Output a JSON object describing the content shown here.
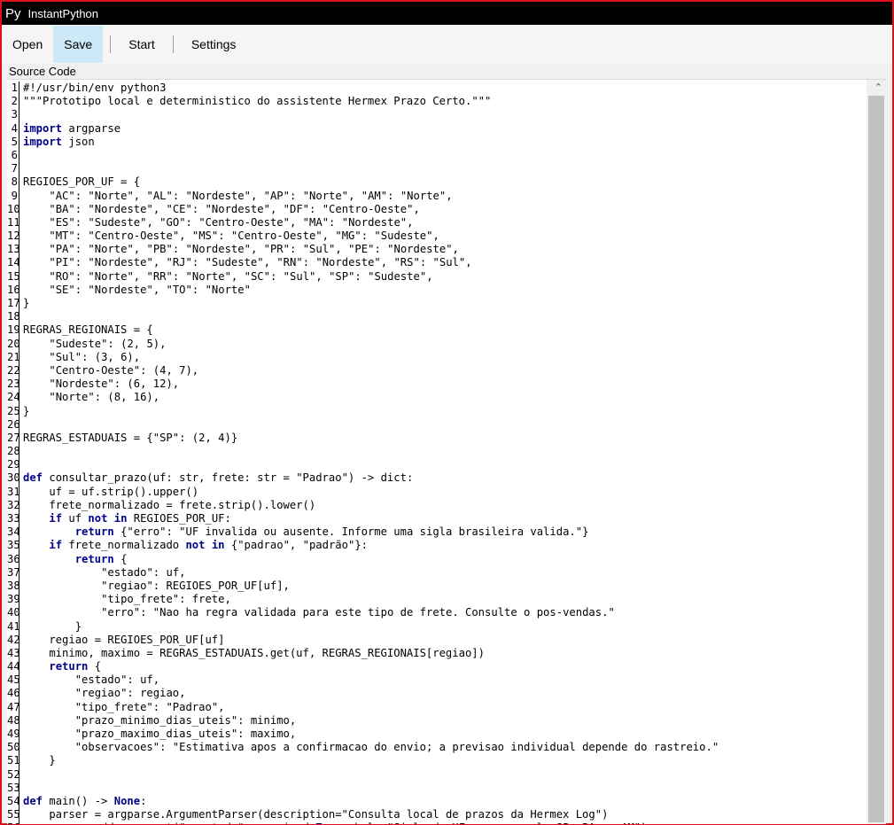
{
  "window": {
    "app_icon": "Py",
    "title": "InstantPython"
  },
  "toolbar": {
    "open": "Open",
    "save": "Save",
    "start": "Start",
    "settings": "Settings"
  },
  "editor": {
    "label": "Source Code",
    "lines": [
      "#!/usr/bin/env python3",
      "\"\"\"Prototipo local e deterministico do assistente Hermex Prazo Certo.\"\"\"",
      "",
      "import argparse",
      "import json",
      "",
      "",
      "REGIOES_POR_UF = {",
      "    \"AC\": \"Norte\", \"AL\": \"Nordeste\", \"AP\": \"Norte\", \"AM\": \"Norte\",",
      "    \"BA\": \"Nordeste\", \"CE\": \"Nordeste\", \"DF\": \"Centro-Oeste\",",
      "    \"ES\": \"Sudeste\", \"GO\": \"Centro-Oeste\", \"MA\": \"Nordeste\",",
      "    \"MT\": \"Centro-Oeste\", \"MS\": \"Centro-Oeste\", \"MG\": \"Sudeste\",",
      "    \"PA\": \"Norte\", \"PB\": \"Nordeste\", \"PR\": \"Sul\", \"PE\": \"Nordeste\",",
      "    \"PI\": \"Nordeste\", \"RJ\": \"Sudeste\", \"RN\": \"Nordeste\", \"RS\": \"Sul\",",
      "    \"RO\": \"Norte\", \"RR\": \"Norte\", \"SC\": \"Sul\", \"SP\": \"Sudeste\",",
      "    \"SE\": \"Nordeste\", \"TO\": \"Norte\"",
      "}",
      "",
      "REGRAS_REGIONAIS = {",
      "    \"Sudeste\": (2, 5),",
      "    \"Sul\": (3, 6),",
      "    \"Centro-Oeste\": (4, 7),",
      "    \"Nordeste\": (6, 12),",
      "    \"Norte\": (8, 16),",
      "}",
      "",
      "REGRAS_ESTADUAIS = {\"SP\": (2, 4)}",
      "",
      "",
      "def consultar_prazo(uf: str, frete: str = \"Padrao\") -> dict:",
      "    uf = uf.strip().upper()",
      "    frete_normalizado = frete.strip().lower()",
      "    if uf not in REGIOES_POR_UF:",
      "        return {\"erro\": \"UF invalida ou ausente. Informe uma sigla brasileira valida.\"}",
      "    if frete_normalizado not in {\"padrao\", \"padrão\"}:",
      "        return {",
      "            \"estado\": uf,",
      "            \"regiao\": REGIOES_POR_UF[uf],",
      "            \"tipo_frete\": frete,",
      "            \"erro\": \"Nao ha regra validada para este tipo de frete. Consulte o pos-vendas.\"",
      "        }",
      "    regiao = REGIOES_POR_UF[uf]",
      "    minimo, maximo = REGRAS_ESTADUAIS.get(uf, REGRAS_REGIONAIS[regiao])",
      "    return {",
      "        \"estado\": uf,",
      "        \"regiao\": regiao,",
      "        \"tipo_frete\": \"Padrao\",",
      "        \"prazo_minimo_dias_uteis\": minimo,",
      "        \"prazo_maximo_dias_uteis\": maximo,",
      "        \"observacoes\": \"Estimativa apos a confirmacao do envio; a previsao individual depende do rastreio.\"",
      "    }",
      "",
      "",
      "def main() -> None:",
      "    parser = argparse.ArgumentParser(description=\"Consulta local de prazos da Hermex Log\")",
      "    parser.add_argument(\"--estado\", required=True, help=\"Sigla da UF, por exemplo SP, BA ou AM\")"
    ]
  },
  "icons": {
    "scroll_up": "chevron-up-icon"
  },
  "colors": {
    "window_border": "#e0101a",
    "titlebar": "#000000",
    "active_button": "#cde8f7",
    "keyword": "#00008b"
  }
}
